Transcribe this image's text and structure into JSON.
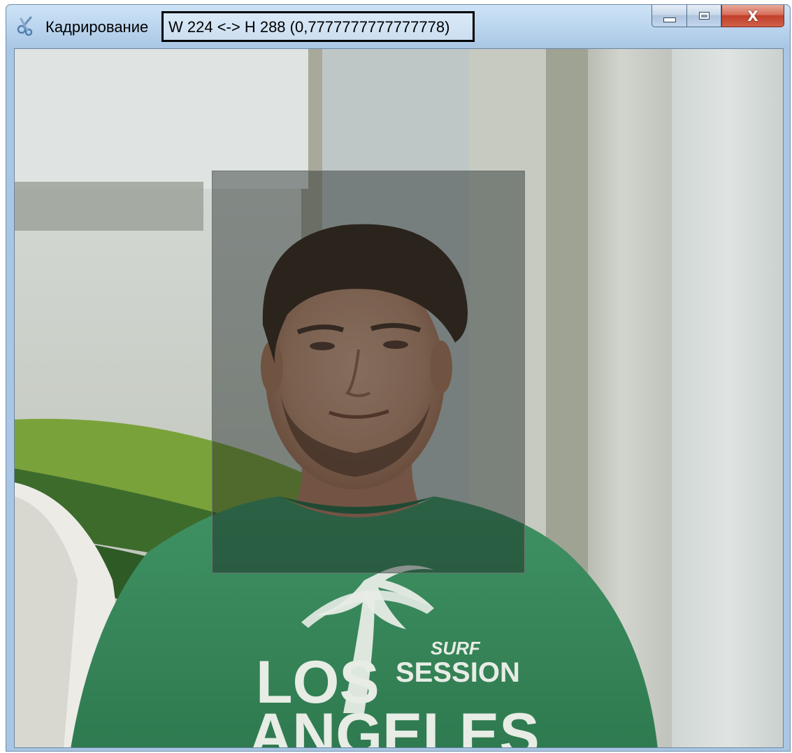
{
  "window": {
    "title": "Кадрирование",
    "dimensions_text": "W 224 <-> H 288 (0,7777777777777778)",
    "app_icon": "crop-tool-icon",
    "buttons": {
      "minimize_icon": "minimize-icon",
      "maximize_icon": "maximize-icon",
      "close_icon": "close-icon",
      "close_label": "X"
    }
  },
  "crop": {
    "width": 224,
    "height": 288,
    "aspect_ratio": 0.7777777777777778
  },
  "photo": {
    "shirt_print_line1": "LOS",
    "shirt_print_line2": "ANGELES",
    "shirt_print_small1": "SURF",
    "shirt_print_small2": "SESSION"
  },
  "colors": {
    "title_bar": "#bcd6ef",
    "close_button": "#c2402a",
    "shirt": "#3b8a5c",
    "crop_overlay": "#141c1a"
  }
}
